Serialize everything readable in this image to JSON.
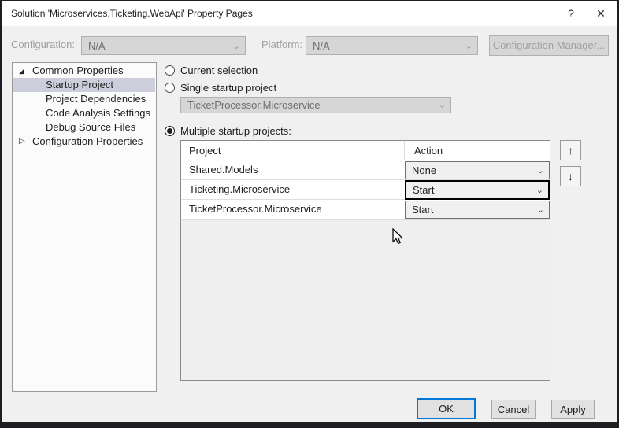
{
  "window": {
    "title": "Solution 'Microservices.Ticketing.WebApi' Property Pages"
  },
  "icons": {
    "help": "?",
    "close": "✕",
    "chevron_down": "⌄",
    "tree_expanded": "◢",
    "tree_collapsed": "▷",
    "move_up": "↑",
    "move_down": "↓"
  },
  "toolbar": {
    "configuration_label": "Configuration:",
    "configuration_value": "N/A",
    "platform_label": "Platform:",
    "platform_value": "N/A",
    "config_manager_label": "Configuration Manager..."
  },
  "tree": {
    "items": [
      {
        "label": "Common Properties",
        "level": 0,
        "state": "expanded",
        "selected": false
      },
      {
        "label": "Startup Project",
        "level": 1,
        "state": "leaf",
        "selected": true
      },
      {
        "label": "Project Dependencies",
        "level": 1,
        "state": "leaf",
        "selected": false
      },
      {
        "label": "Code Analysis Settings",
        "level": 1,
        "state": "leaf",
        "selected": false
      },
      {
        "label": "Debug Source Files",
        "level": 1,
        "state": "leaf",
        "selected": false
      },
      {
        "label": "Configuration Properties",
        "level": 0,
        "state": "collapsed",
        "selected": false
      }
    ]
  },
  "main": {
    "radio_current_label": "Current selection",
    "radio_single_label": "Single startup project",
    "single_project_value": "TicketProcessor.Microservice",
    "radio_multiple_label": "Multiple startup projects:",
    "selected_mode": "multiple",
    "table": {
      "columns": [
        "Project",
        "Action"
      ],
      "rows": [
        {
          "project": "Shared.Models",
          "action": "None",
          "focused": false
        },
        {
          "project": "Ticketing.Microservice",
          "action": "Start",
          "focused": true
        },
        {
          "project": "TicketProcessor.Microservice",
          "action": "Start",
          "focused": false
        }
      ]
    }
  },
  "footer": {
    "ok_label": "OK",
    "cancel_label": "Cancel",
    "apply_label": "Apply"
  },
  "colors": {
    "accent": "#0078d7",
    "selection_bg": "#cccedb",
    "dialog_bg": "#f0f0f0",
    "titlebar_bg": "#ffffff",
    "outer_bg": "#1d1e22",
    "disabled_fill": "#d6d6d6"
  }
}
